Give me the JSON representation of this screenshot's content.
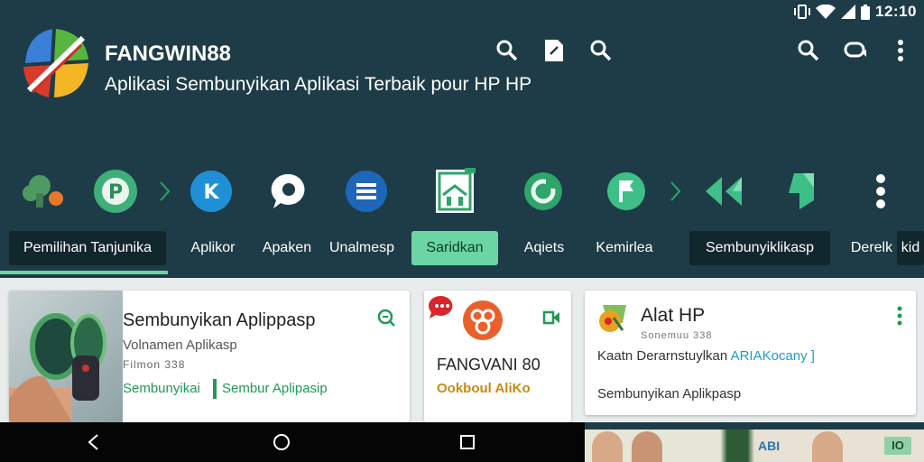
{
  "status": {
    "time": "12:10"
  },
  "app": {
    "title": "FANGWIN88",
    "subtitle": "Aplikasi Sembunyikan Aplikasi Terbaik pour HP HP"
  },
  "toolbar": {
    "actions": [
      "search-icon",
      "edit-note-icon",
      "search-icon",
      "search-icon",
      "chat-icon",
      "more-vert-icon"
    ]
  },
  "tabs": [
    {
      "label": "Pemilihan Tanjunika",
      "style": "dark"
    },
    {
      "label": "Aplikor",
      "style": "plain"
    },
    {
      "label": "Apaken",
      "style": "plain"
    },
    {
      "label": "Unalmesp",
      "style": "plain"
    },
    {
      "label": "Saridkan",
      "style": "active"
    },
    {
      "label": "Aqiets",
      "style": "plain"
    },
    {
      "label": "Kemirlea",
      "style": "plain"
    },
    {
      "label": "Sembunyiklikasp",
      "style": "dark"
    },
    {
      "label": "Derelk",
      "style": "plain"
    },
    {
      "label": "kid",
      "style": "dark"
    }
  ],
  "cards": {
    "card1": {
      "title": "Sembunyikan Aplippasp",
      "subtitle": "Volnamen Aplikasp",
      "meta": "Filmon 338",
      "link_a": "Sembunyikai",
      "link_b": "Sembur Aplipasip"
    },
    "card2": {
      "title": "FANGVANI 80",
      "subtitle": "Ookboul AliKo"
    },
    "card3": {
      "title": "Alat  HP",
      "meta": "Sonemuu 338",
      "line_prefix": "Kaatn  Derarnstuylkan",
      "line_link": "ARIAKocany ]",
      "bottom": "Sembunyikan Aplikpasp"
    }
  },
  "promo": {
    "label": "ABI",
    "tag": "IO"
  },
  "colors": {
    "appbar_bg": "#1e3c48",
    "accent_green": "#6bd6a3",
    "link_green": "#1f9a55",
    "link_blue": "#1f9cc4"
  }
}
